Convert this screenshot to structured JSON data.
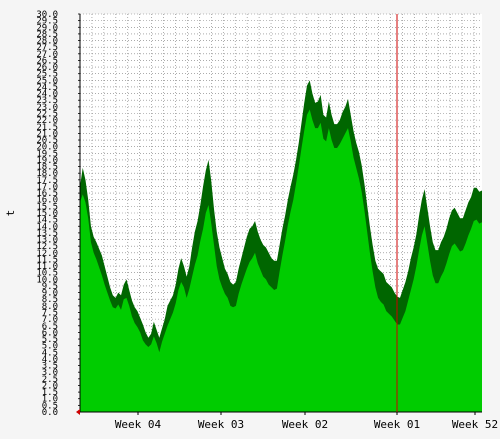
{
  "chart_data": {
    "type": "area",
    "ylabel": "t",
    "ylim": [
      0,
      30
    ],
    "y_tick_step": 0.5,
    "y_tick_labels": [
      "0.0",
      "0.5",
      "1.0",
      "1.5",
      "2.0",
      "2.5",
      "3.0",
      "3.5",
      "4.0",
      "4.5",
      "5.0",
      "5.5",
      "6.0",
      "6.5",
      "7.0",
      "7.5",
      "8.0",
      "8.5",
      "9.0",
      "9.5",
      "10.0",
      "10.5",
      "11.0",
      "11.5",
      "12.0",
      "12.5",
      "13.0",
      "13.5",
      "14.0",
      "14.5",
      "15.0",
      "15.5",
      "16.0",
      "16.5",
      "17.0",
      "17.5",
      "18.0",
      "18.5",
      "19.0",
      "19.5",
      "20.0",
      "20.5",
      "21.0",
      "21.5",
      "22.0",
      "22.5",
      "23.0",
      "23.5",
      "24.0",
      "24.5",
      "25.0",
      "25.5",
      "26.0",
      "26.5",
      "27.0",
      "27.5",
      "28.0",
      "28.5",
      "29.0",
      "29.5",
      "30.0"
    ],
    "x_tick_labels": [
      "Week 04",
      "Week 03",
      "Week 02",
      "Week 01",
      "Week 52"
    ],
    "grid": true,
    "series": [
      {
        "role": "max",
        "color": "#006600",
        "values": [
          17.0,
          18.4,
          17.5,
          16.0,
          14.0,
          13.2,
          12.8,
          12.3,
          11.8,
          11.0,
          10.2,
          9.4,
          8.8,
          8.6,
          9.0,
          8.8,
          9.6,
          10.0,
          9.2,
          8.4,
          7.9,
          7.6,
          7.1,
          6.6,
          6.0,
          5.6,
          5.9,
          6.8,
          6.2,
          5.6,
          6.3,
          7.0,
          8.0,
          8.4,
          8.8,
          9.6,
          10.8,
          11.6,
          11.0,
          10.2,
          11.0,
          12.4,
          13.6,
          14.4,
          15.6,
          17.0,
          18.2,
          19.0,
          17.4,
          15.3,
          13.6,
          12.4,
          11.6,
          10.8,
          10.4,
          9.8,
          9.6,
          9.8,
          10.8,
          11.6,
          12.4,
          13.2,
          13.8,
          14.0,
          14.4,
          13.6,
          13.0,
          12.6,
          12.4,
          12.0,
          11.6,
          11.4,
          11.4,
          12.6,
          13.8,
          14.8,
          16.0,
          17.0,
          17.9,
          19.0,
          20.3,
          21.8,
          23.3,
          24.6,
          25.0,
          24.0,
          23.3,
          23.4,
          23.9,
          22.4,
          22.2,
          23.4,
          22.4,
          21.7,
          21.7,
          22.0,
          22.6,
          23.0,
          23.6,
          22.4,
          21.2,
          20.3,
          19.6,
          18.6,
          17.2,
          15.6,
          14.0,
          12.6,
          11.4,
          10.8,
          10.6,
          10.4,
          9.8,
          9.6,
          9.4,
          9.0,
          8.7,
          8.6,
          9.2,
          9.8,
          10.6,
          11.6,
          12.4,
          13.4,
          14.8,
          16.0,
          16.8,
          15.4,
          14.0,
          12.8,
          12.2,
          12.2,
          12.8,
          13.2,
          13.8,
          14.6,
          15.2,
          15.4,
          15.0,
          14.6,
          14.6,
          15.2,
          15.8,
          16.2,
          16.9,
          16.9,
          16.6,
          16.7
        ]
      },
      {
        "role": "avg",
        "color": "#00cc00",
        "values": [
          15.8,
          16.4,
          15.8,
          14.6,
          12.8,
          12.0,
          11.5,
          10.9,
          10.3,
          9.6,
          9.0,
          8.4,
          7.9,
          7.8,
          8.1,
          7.7,
          8.5,
          8.6,
          8.0,
          7.2,
          6.7,
          6.4,
          6.0,
          5.4,
          5.1,
          4.9,
          5.1,
          5.7,
          5.2,
          4.5,
          5.3,
          5.9,
          6.5,
          7.0,
          7.5,
          8.2,
          9.2,
          9.8,
          9.4,
          8.6,
          9.3,
          10.2,
          11.1,
          11.8,
          12.9,
          13.8,
          15.0,
          15.6,
          14.2,
          12.6,
          11.0,
          10.0,
          9.4,
          8.9,
          8.6,
          8.0,
          7.9,
          8.0,
          8.9,
          9.6,
          10.2,
          10.8,
          11.3,
          11.6,
          12.0,
          11.2,
          10.7,
          10.2,
          10.0,
          9.6,
          9.4,
          9.2,
          9.3,
          10.6,
          11.8,
          12.9,
          14.1,
          15.1,
          16.0,
          17.2,
          18.5,
          19.9,
          21.2,
          22.4,
          22.8,
          22.0,
          21.4,
          21.4,
          21.8,
          20.6,
          20.4,
          21.4,
          20.5,
          19.9,
          19.9,
          20.2,
          20.6,
          21.0,
          21.4,
          20.4,
          19.2,
          18.4,
          17.6,
          16.6,
          15.2,
          13.6,
          12.0,
          10.6,
          9.4,
          8.6,
          8.3,
          8.1,
          7.6,
          7.4,
          7.2,
          6.9,
          6.6,
          6.6,
          7.1,
          7.6,
          8.4,
          9.2,
          10.0,
          11.0,
          12.2,
          13.3,
          14.0,
          12.7,
          11.4,
          10.3,
          9.7,
          9.7,
          10.2,
          10.6,
          11.2,
          11.9,
          12.5,
          12.7,
          12.4,
          12.1,
          12.2,
          12.7,
          13.3,
          13.8,
          14.4,
          14.5,
          14.2,
          14.3
        ]
      }
    ],
    "now_marker_color": "#cc0000",
    "colors": {
      "canvas_background": "#f5f5f5",
      "plot_background": "#ffffff",
      "grid": "#7a7a7a",
      "axis": "#000000",
      "text": "#000000",
      "avg_area": "#00cc00",
      "max_area": "#006600"
    }
  }
}
